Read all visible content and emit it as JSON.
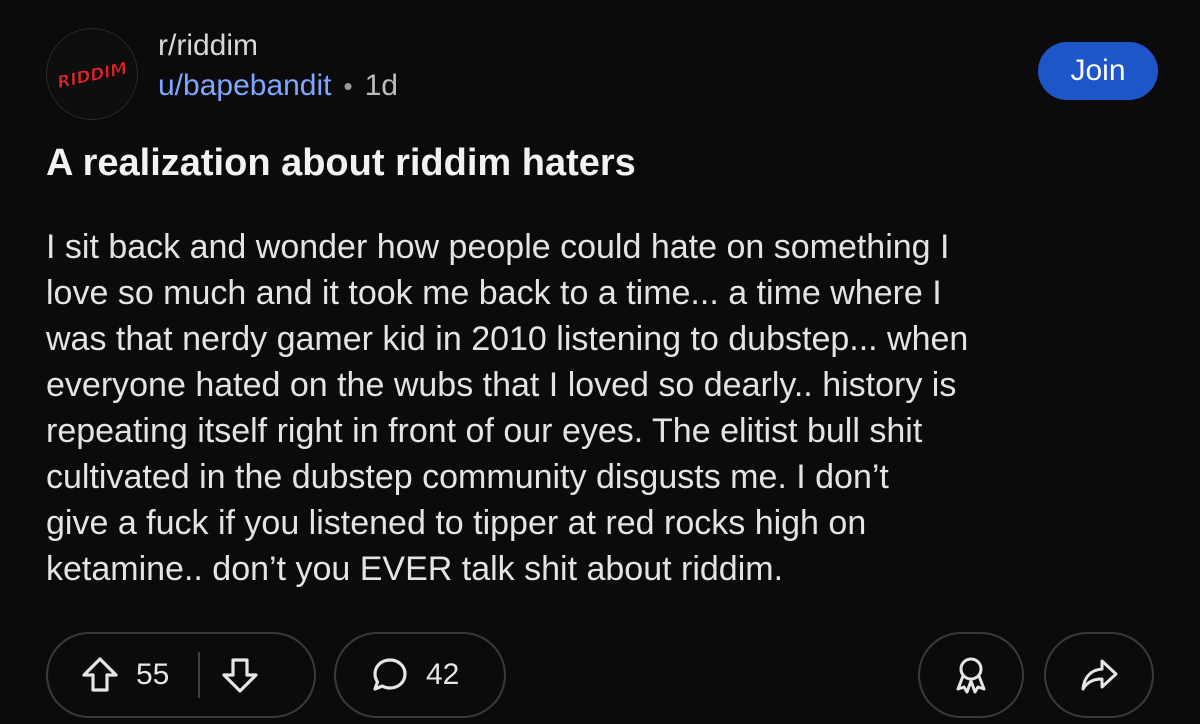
{
  "header": {
    "avatar_logo_text": "RIDDIM",
    "subreddit": "r/riddim",
    "username": "u/bapebandit",
    "separator": "•",
    "age": "1d",
    "join_label": "Join"
  },
  "post": {
    "title": "A realization about riddim haters",
    "body_lines": [
      "I sit back and wonder how people could hate on something I",
      "love so much and it took me back to a time... a time where I",
      "was that nerdy gamer kid in 2010 listening to dubstep... when",
      "everyone hated on the wubs that I loved so dearly.. history is",
      "repeating itself right in front of our eyes. The elitist bull shit",
      "cultivated in the dubstep community disgusts me. I don’t",
      "give a fuck if you listened to tipper at red rocks high on",
      "ketamine.. don’t you EVER talk shit about riddim."
    ]
  },
  "actions": {
    "score": "55",
    "comments": "42",
    "icons": {
      "upvote": "upvote-arrow-icon",
      "downvote": "downvote-arrow-icon",
      "comment": "comment-bubble-icon",
      "award": "award-icon",
      "share": "share-arrow-icon"
    }
  },
  "colors": {
    "background": "#0b0b0b",
    "join_button": "#1e55c8",
    "username": "#7fa7ff",
    "logo_red": "#d9262b"
  }
}
